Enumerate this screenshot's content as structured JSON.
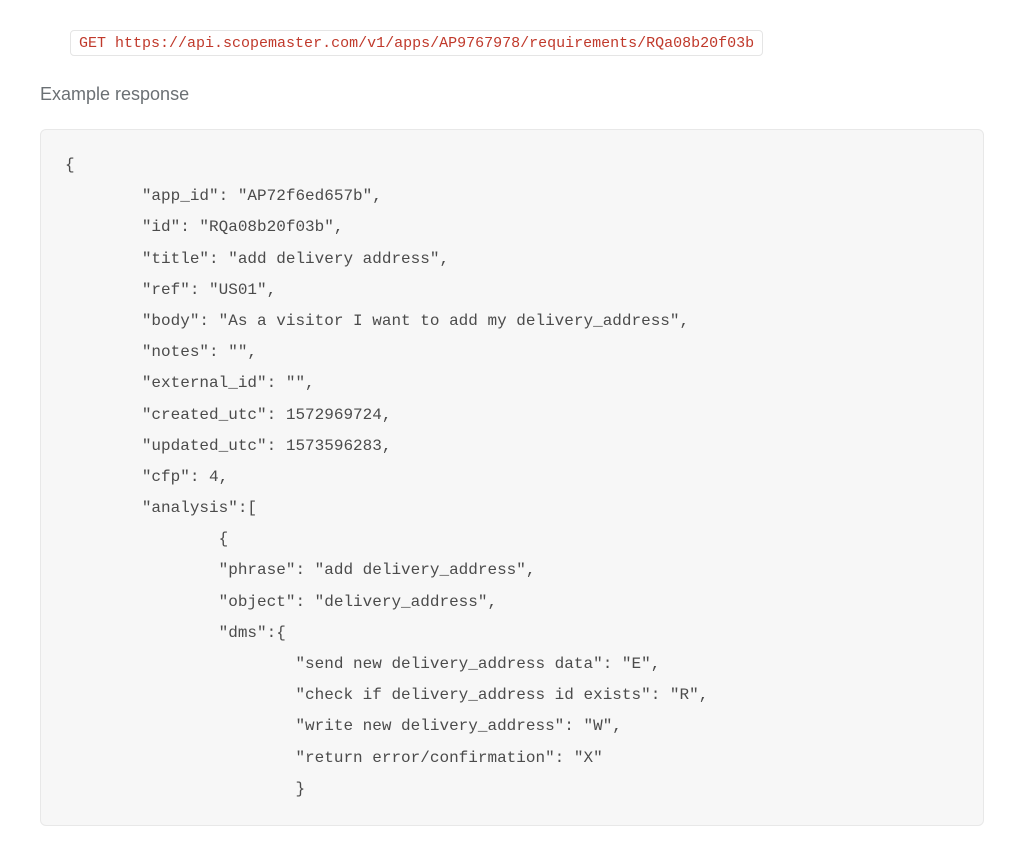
{
  "request": {
    "method": "GET",
    "url": "https://api.scopemaster.com/v1/apps/AP9767978/requirements/RQa08b20f03b"
  },
  "section_heading": "Example response",
  "response": {
    "app_id": "AP72f6ed657b",
    "id": "RQa08b20f03b",
    "title": "add delivery address",
    "ref": "US01",
    "body": "As a visitor I want to add my delivery_address",
    "notes": "",
    "external_id": "",
    "created_utc": 1572969724,
    "updated_utc": 1573596283,
    "cfp": 4,
    "analysis": [
      {
        "phrase": "add delivery_address",
        "object": "delivery_address",
        "dms": {
          "send new delivery_address data": "E",
          "check if delivery_address id exists": "R",
          "write new delivery_address": "W",
          "return error/confirmation": "X"
        }
      }
    ]
  }
}
